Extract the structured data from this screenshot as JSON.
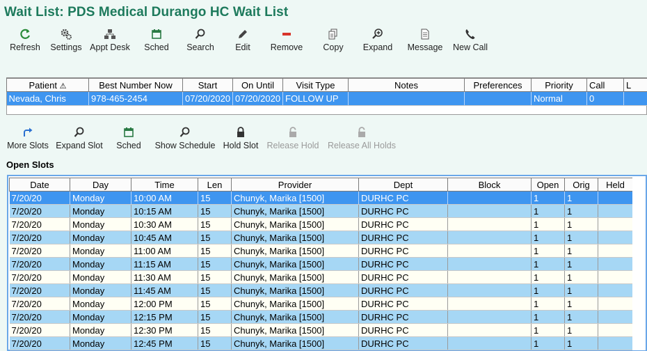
{
  "window": {
    "title": "Wait List: PDS Medical Durango HC Wait List"
  },
  "colors": {
    "title": "#1d7a5c",
    "selected": "#3e95f0",
    "alt_row": "#a6d7f5",
    "row": "#fffff4"
  },
  "toolbar": [
    {
      "label": "Refresh",
      "icon": "refresh-icon"
    },
    {
      "label": "Settings",
      "icon": "gear-icon"
    },
    {
      "label": "Appt Desk",
      "icon": "hierarchy-icon"
    },
    {
      "label": "Sched",
      "icon": "calendar-icon"
    },
    {
      "label": "Search",
      "icon": "magnifier-icon"
    },
    {
      "label": "Edit",
      "icon": "pencil-icon"
    },
    {
      "label": "Remove",
      "icon": "minus-icon"
    },
    {
      "label": "Copy",
      "icon": "copy-icon"
    },
    {
      "label": "Expand",
      "icon": "zoom-in-icon"
    },
    {
      "label": "Message",
      "icon": "document-icon"
    },
    {
      "label": "New Call",
      "icon": "phone-icon"
    }
  ],
  "waitlist": {
    "columns": [
      "Patient",
      "Best Number Now",
      "Start",
      "On Until",
      "Visit Type",
      "Notes",
      "Preferences",
      "Priority",
      "Call",
      "L"
    ],
    "rows": [
      [
        "Nevada, Chris",
        "978-465-2454",
        "07/20/2020",
        "07/20/2020",
        "FOLLOW UP",
        "",
        "",
        "Normal",
        "0",
        ""
      ]
    ]
  },
  "slot_toolbar": [
    {
      "label": "More Slots",
      "icon": "share-arrow-icon",
      "enabled": true
    },
    {
      "label": "Expand Slot",
      "icon": "magnifier-icon",
      "enabled": true
    },
    {
      "label": "Sched",
      "icon": "calendar-icon",
      "enabled": true
    },
    {
      "label": "Show Schedule",
      "icon": "magnifier-icon",
      "enabled": true
    },
    {
      "label": "Hold Slot",
      "icon": "lock-icon",
      "enabled": true
    },
    {
      "label": "Release Hold",
      "icon": "unlock-icon",
      "enabled": false
    },
    {
      "label": "Release All Holds",
      "icon": "unlock-icon",
      "enabled": false
    }
  ],
  "open_slots": {
    "label": "Open Slots",
    "columns": [
      "Date",
      "Day",
      "Time",
      "Len",
      "Provider",
      "Dept",
      "Block",
      "Open",
      "Orig",
      "Held"
    ],
    "rows": [
      [
        "7/20/20",
        "Monday",
        "10:00 AM",
        "15",
        "Chunyk, Marika [1500]",
        "DURHC PC",
        "",
        "1",
        "1",
        ""
      ],
      [
        "7/20/20",
        "Monday",
        "10:15 AM",
        "15",
        "Chunyk, Marika [1500]",
        "DURHC PC",
        "",
        "1",
        "1",
        ""
      ],
      [
        "7/20/20",
        "Monday",
        "10:30 AM",
        "15",
        "Chunyk, Marika [1500]",
        "DURHC PC",
        "",
        "1",
        "1",
        ""
      ],
      [
        "7/20/20",
        "Monday",
        "10:45 AM",
        "15",
        "Chunyk, Marika [1500]",
        "DURHC PC",
        "",
        "1",
        "1",
        ""
      ],
      [
        "7/20/20",
        "Monday",
        "11:00 AM",
        "15",
        "Chunyk, Marika [1500]",
        "DURHC PC",
        "",
        "1",
        "1",
        ""
      ],
      [
        "7/20/20",
        "Monday",
        "11:15 AM",
        "15",
        "Chunyk, Marika [1500]",
        "DURHC PC",
        "",
        "1",
        "1",
        ""
      ],
      [
        "7/20/20",
        "Monday",
        "11:30 AM",
        "15",
        "Chunyk, Marika [1500]",
        "DURHC PC",
        "",
        "1",
        "1",
        ""
      ],
      [
        "7/20/20",
        "Monday",
        "11:45 AM",
        "15",
        "Chunyk, Marika [1500]",
        "DURHC PC",
        "",
        "1",
        "1",
        ""
      ],
      [
        "7/20/20",
        "Monday",
        "12:00 PM",
        "15",
        "Chunyk, Marika [1500]",
        "DURHC PC",
        "",
        "1",
        "1",
        ""
      ],
      [
        "7/20/20",
        "Monday",
        "12:15 PM",
        "15",
        "Chunyk, Marika [1500]",
        "DURHC PC",
        "",
        "1",
        "1",
        ""
      ],
      [
        "7/20/20",
        "Monday",
        "12:30 PM",
        "15",
        "Chunyk, Marika [1500]",
        "DURHC PC",
        "",
        "1",
        "1",
        ""
      ],
      [
        "7/20/20",
        "Monday",
        "12:45 PM",
        "15",
        "Chunyk, Marika [1500]",
        "DURHC PC",
        "",
        "1",
        "1",
        ""
      ]
    ]
  }
}
